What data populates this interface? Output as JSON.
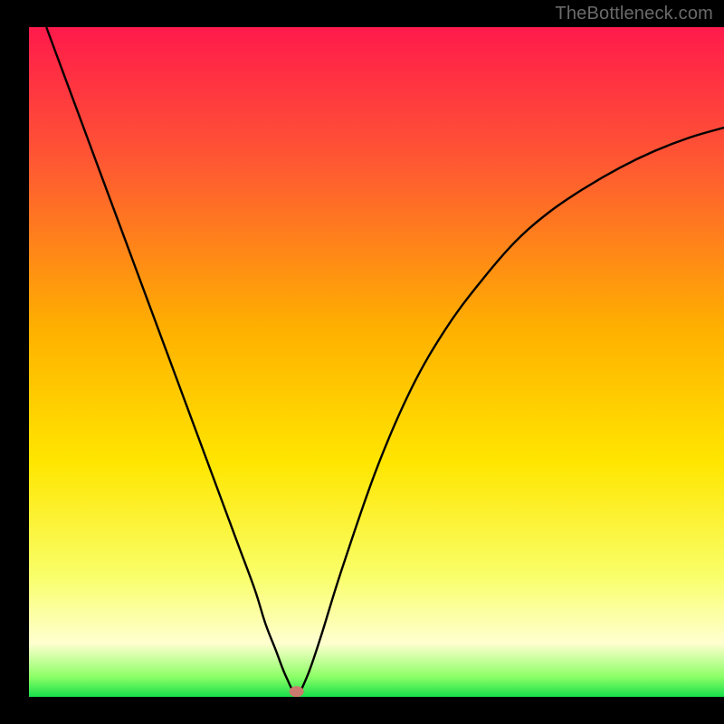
{
  "watermark": "TheBottleneck.com",
  "marker": {
    "x_pct": 38.5,
    "color": "#cb7a6d"
  },
  "chart_data": {
    "type": "line",
    "title": "",
    "xlabel": "",
    "ylabel": "",
    "xlim": [
      0,
      100
    ],
    "ylim": [
      0,
      100
    ],
    "grid": false,
    "legend": false,
    "note": "V-shaped bottleneck curve; x is relative position (%), y is bottleneck magnitude (%). Minimum at x≈38.5%.",
    "series": [
      {
        "name": "bottleneck-curve",
        "x": [
          2.5,
          5,
          7.5,
          10,
          12.5,
          15,
          17.5,
          20,
          22.5,
          25,
          27.5,
          30,
          32.5,
          34,
          35.5,
          37,
          38.5,
          40,
          42,
          45,
          50,
          55,
          60,
          65,
          70,
          75,
          80,
          85,
          90,
          95,
          100
        ],
        "y": [
          100,
          93,
          86,
          79,
          72,
          65,
          58,
          51,
          44,
          37,
          30,
          23,
          16,
          11,
          7,
          3,
          0.5,
          3,
          9,
          19,
          34,
          46,
          55,
          62,
          68,
          72.5,
          76,
          79,
          81.5,
          83.5,
          85
        ]
      }
    ],
    "background_gradient": {
      "type": "vertical",
      "stops": [
        {
          "pct": 0,
          "color": "#ff1a4b"
        },
        {
          "pct": 20,
          "color": "#ff5733"
        },
        {
          "pct": 45,
          "color": "#ffb000"
        },
        {
          "pct": 65,
          "color": "#ffe600"
        },
        {
          "pct": 82,
          "color": "#f9ff6a"
        },
        {
          "pct": 92,
          "color": "#ffffd0"
        },
        {
          "pct": 97,
          "color": "#8cff66"
        },
        {
          "pct": 100,
          "color": "#18e04a"
        }
      ]
    },
    "marker_point": {
      "x": 38.5,
      "y": 0.8,
      "color": "#cb7a6d"
    }
  }
}
